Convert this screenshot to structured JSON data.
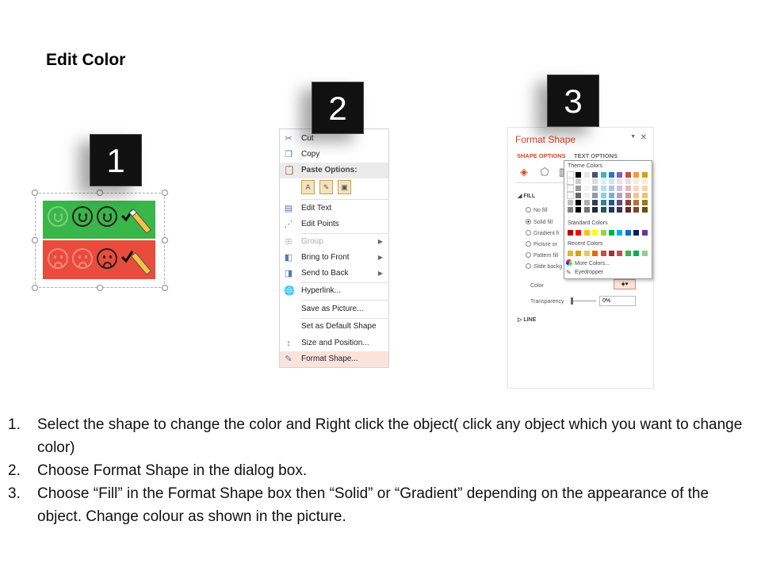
{
  "title": "Edit Color",
  "badges": [
    "1",
    "2",
    "3"
  ],
  "context_menu": {
    "items": [
      {
        "label": "Cut",
        "icon": "scissors-icon",
        "state": "normal"
      },
      {
        "label": "Copy",
        "icon": "copy-icon",
        "state": "normal"
      },
      {
        "label": "Paste Options:",
        "icon": "paste-icon",
        "state": "header"
      },
      {
        "label": "Edit Text",
        "icon": "edit-text-icon",
        "state": "normal"
      },
      {
        "label": "Edit Points",
        "icon": "edit-points-icon",
        "state": "normal"
      },
      {
        "label": "Group",
        "icon": "group-icon",
        "state": "disabled"
      },
      {
        "label": "Bring to Front",
        "icon": "bring-front-icon",
        "state": "normal"
      },
      {
        "label": "Send to Back",
        "icon": "send-back-icon",
        "state": "normal"
      },
      {
        "label": "Hyperlink...",
        "icon": "hyperlink-icon",
        "state": "normal"
      },
      {
        "label": "Save as Picture...",
        "icon": "",
        "state": "normal"
      },
      {
        "label": "Set as Default Shape",
        "icon": "",
        "state": "normal"
      },
      {
        "label": "Size and Position...",
        "icon": "size-position-icon",
        "state": "normal"
      },
      {
        "label": "Format Shape...",
        "icon": "format-shape-icon",
        "state": "highlighted"
      }
    ]
  },
  "format_pane": {
    "title": "Format Shape",
    "tab_active": "SHAPE OPTIONS",
    "tab_other": "TEXT OPTIONS",
    "section_fill": "FILL",
    "fill_options": [
      "No fill",
      "Solid fill",
      "Gradient fi",
      "Picture or",
      "Pattern fill",
      "Slide backg"
    ],
    "color_label": "Color",
    "transparency_label": "Transparency",
    "transparency_value": "0%",
    "section_line": "LINE",
    "accent_color": "#d24726"
  },
  "color_picker": {
    "theme_label": "Theme Colors",
    "standard_label": "Standard Colors",
    "recent_label": "Recent Colors",
    "more_colors": "More Colors...",
    "eyedropper": "Eyedropper",
    "theme_top": [
      "#ffffff",
      "#000000",
      "#e7e6e6",
      "#44546a",
      "#4bacc6",
      "#2e75b6",
      "#8064a2",
      "#c0504d",
      "#f79646",
      "#d4a017"
    ],
    "standard": [
      "#c00000",
      "#ff0000",
      "#ffc000",
      "#ffff00",
      "#92d050",
      "#00b050",
      "#00b0f0",
      "#0070c0",
      "#002060",
      "#7030a0"
    ],
    "recent": [
      "#e2b53c",
      "#d4a017",
      "#f2c45a",
      "#e36c09",
      "#c0504d",
      "#953735",
      "#c0504d",
      "#3ab54a",
      "#00b050",
      "#8fd08f"
    ]
  },
  "instructions": [
    {
      "num": "1.",
      "text": "Select the shape to change the color and Right click the object( click any object which you want to change color)"
    },
    {
      "num": "2.",
      "text": "Choose Format Shape in the dialog box."
    },
    {
      "num": "3.",
      "text": "Choose “Fill” in the Format Shape box then “Solid” or “Gradient” depending on the appearance of the object. Change colour as shown in the picture."
    }
  ]
}
